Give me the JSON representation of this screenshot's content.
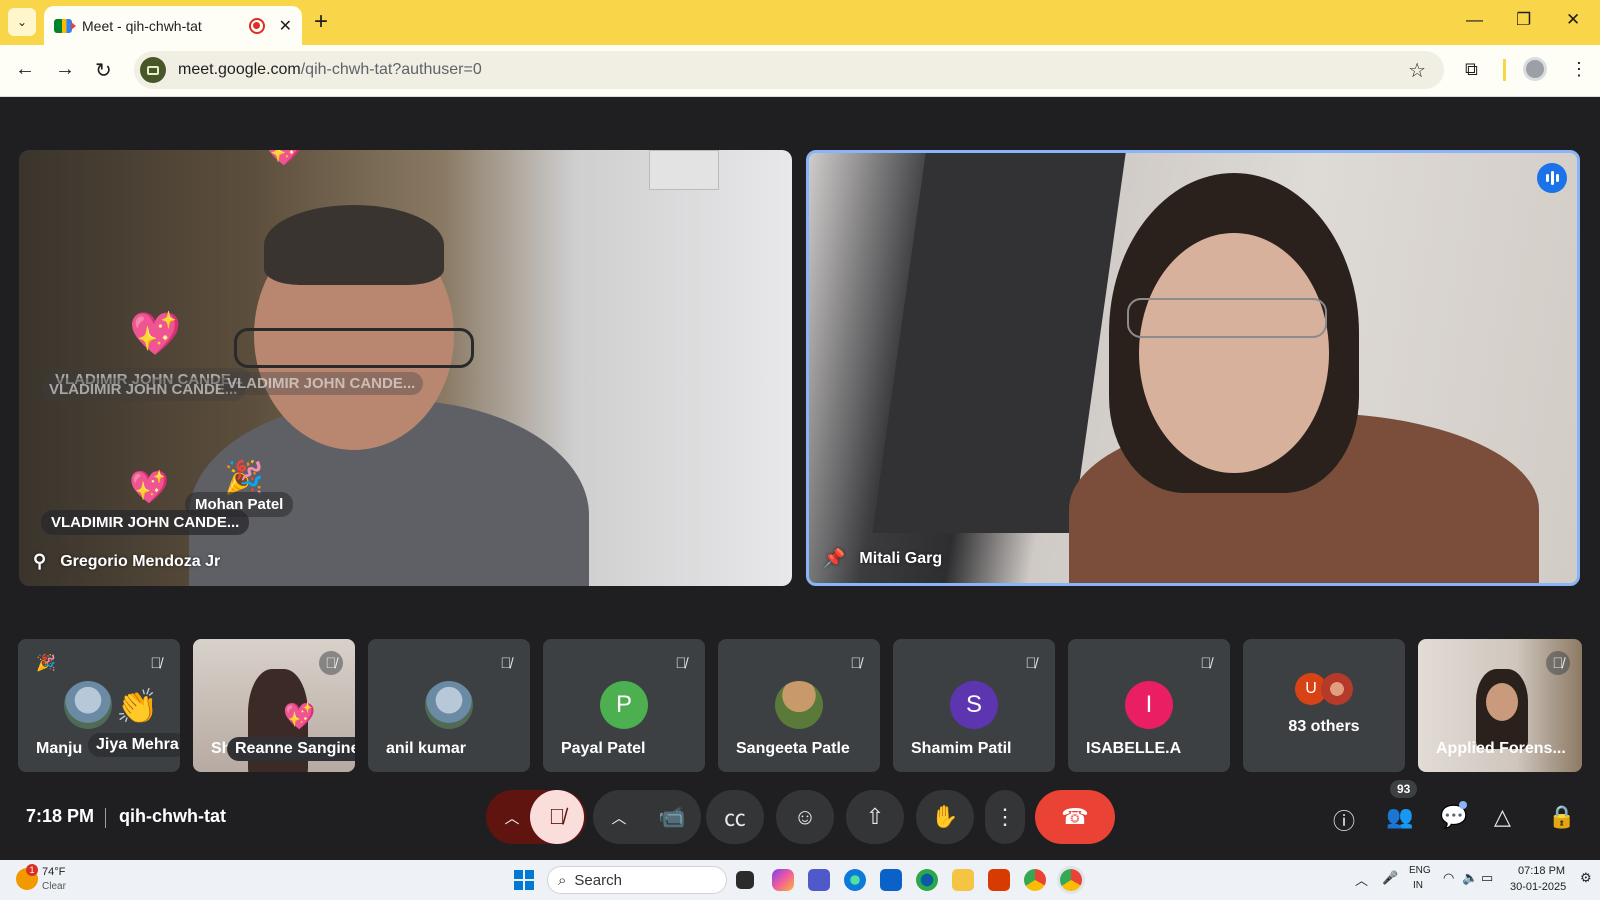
{
  "browser": {
    "tab_title": "Meet - qih-chwh-tat",
    "url_host": "meet.google.com",
    "url_path": "/qih-chwh-tat?authuser=0"
  },
  "main_tiles": [
    {
      "name": "Gregorio Mendoza Jr",
      "overlays": [
        "VLADIMIR JOHN CANDE...",
        "Mohan Patel"
      ],
      "ghost_labels": [
        "VLADIMIR JOHN CANDE...",
        "VLADIMIR JOHN CANDE...",
        "VLADIMIR JOHN CANDE..."
      ]
    },
    {
      "name": "Mitali Garg"
    }
  ],
  "filmstrip": [
    {
      "name": "Manju",
      "chip": "Jiya Mehra"
    },
    {
      "name": "Sh",
      "chip": "Reanne Sangines"
    },
    {
      "name": "anil kumar"
    },
    {
      "name": "Payal Patel",
      "initial": "P",
      "color": "#4caf50"
    },
    {
      "name": "Sangeeta Patle"
    },
    {
      "name": "Shamim Patil",
      "initial": "S",
      "color": "#5e35b1"
    },
    {
      "name": "ISABELLE.A",
      "initial": "I",
      "color": "#e91e63"
    },
    {
      "name": "83 others",
      "initial": "U",
      "color": "#d84315"
    },
    {
      "name": "Applied Forens..."
    }
  ],
  "meeting": {
    "time": "7:18 PM",
    "code": "qih-chwh-tat",
    "people_count": "93"
  },
  "taskbar": {
    "weather_badge": "1",
    "temp": "74°F",
    "weather": "Clear",
    "search_placeholder": "Search",
    "lang_top": "ENG",
    "lang_bottom": "IN",
    "clock_time": "07:18 PM",
    "clock_date": "30-01-2025"
  },
  "colors": {
    "accent": "#8ab4f8",
    "end_call": "#ea4335",
    "mic_muted_bg": "#f9dedc",
    "tab_strip": "#f8d549"
  },
  "icons": [
    "tab-search-icon",
    "new-tab-icon",
    "back-icon",
    "forward-icon",
    "reload-icon",
    "bookmark-star-icon",
    "extensions-icon",
    "profile-icon",
    "menu-icon",
    "mic-off-icon",
    "camera-icon",
    "captions-icon",
    "emoji-icon",
    "present-icon",
    "raise-hand-icon",
    "more-options-icon",
    "end-call-icon",
    "info-icon",
    "people-icon",
    "chat-icon",
    "activities-icon",
    "host-controls-icon"
  ]
}
